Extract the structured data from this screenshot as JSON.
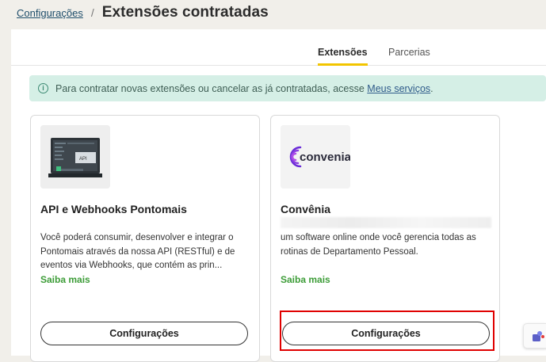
{
  "breadcrumb": {
    "parent": "Configurações",
    "separator": "/",
    "title": "Extensões contratadas"
  },
  "tabs": [
    {
      "label": "Extensões",
      "active": true
    },
    {
      "label": "Parcerias",
      "active": false
    }
  ],
  "alert": {
    "icon": "info-icon",
    "text": "Para contratar novas extensões ou cancelar as já contratadas, acesse ",
    "link": "Meus serviços",
    "suffix": "."
  },
  "cards": [
    {
      "title": "API e Webhooks Pontomais",
      "description": "Você poderá consumir, desenvolver e integrar o Pontomais através da nossa API (RESTful) e de eventos via Webhooks, que contém as prin...",
      "more": "Saiba mais",
      "button": "Configurações",
      "logo": {
        "type": "api-screen-icon",
        "label": "API"
      }
    },
    {
      "title": "Convênia",
      "description": "um software online onde você gerencia todas as rotinas de Departamento Pessoal.",
      "more": "Saiba mais",
      "button": "Configurações",
      "logo": {
        "type": "convenia-logo",
        "label": "convenia"
      }
    }
  ],
  "colors": {
    "accent_tab": "#f2c500",
    "alert_bg": "#d5efe6",
    "link_green": "#3c9c37",
    "highlight": "#e00000",
    "convenia_purple": "#6a2bd8"
  }
}
